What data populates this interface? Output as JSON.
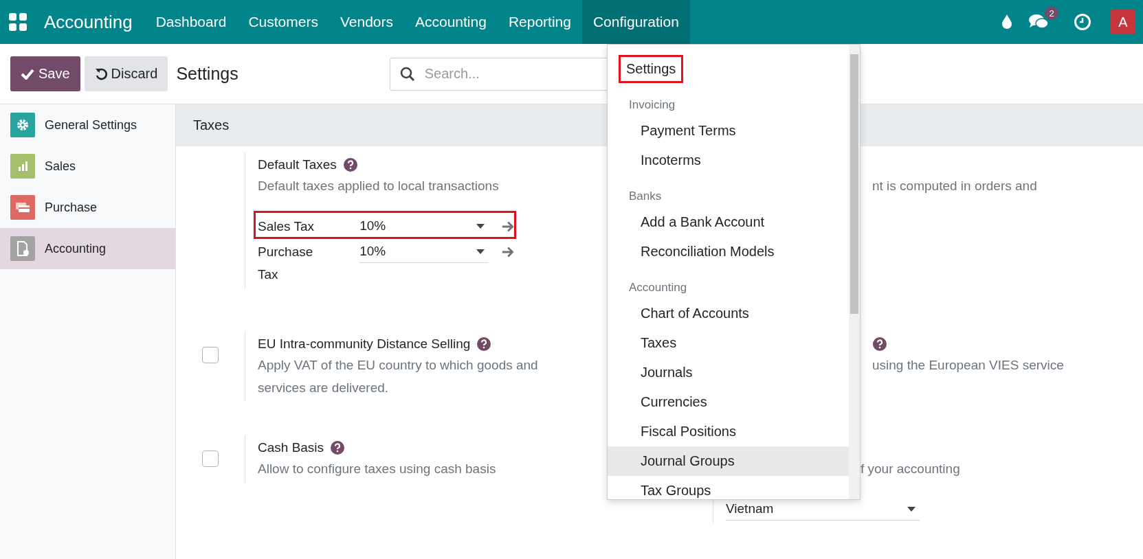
{
  "navbar": {
    "app": "Accounting",
    "menus": [
      {
        "label": "Dashboard",
        "selected": false
      },
      {
        "label": "Customers",
        "selected": false
      },
      {
        "label": "Vendors",
        "selected": false
      },
      {
        "label": "Accounting",
        "selected": false
      },
      {
        "label": "Reporting",
        "selected": false
      },
      {
        "label": "Configuration",
        "selected": true
      }
    ],
    "chat_count": "2",
    "avatar": "A"
  },
  "control_panel": {
    "buttons": [
      {
        "label": "Save",
        "kind": "primary"
      },
      {
        "label": "Discard",
        "kind": "secondary"
      }
    ],
    "title": "Settings",
    "search": {
      "placeholder": "Search..."
    }
  },
  "sidebar": {
    "items": [
      {
        "label": "General Settings",
        "color": "#27a3a0",
        "selected": false
      },
      {
        "label": "Sales",
        "color": "#a6bf6e",
        "selected": false
      },
      {
        "label": "Purchase",
        "color": "#dc6a63",
        "selected": false
      },
      {
        "label": "Accounting",
        "color": "#a3a3a3",
        "selected": true
      }
    ]
  },
  "section": {
    "title": "Taxes",
    "rows": [
      {
        "left": {
          "kind": "fields",
          "title": "Default Taxes",
          "help": true,
          "description": "Default taxes applied to local transactions",
          "fields": [
            {
              "label": "Sales Tax",
              "value": "10%",
              "highlighted": true
            },
            {
              "label": "Purchase Tax",
              "value": "10%",
              "highlighted": false
            }
          ]
        },
        "right": {
          "description": "nt is computed in orders and"
        }
      },
      {
        "left": {
          "kind": "checkbox",
          "title": "EU Intra-community Distance Selling",
          "help": true,
          "description": "Apply VAT of the EU country to which goods and services are delivered.",
          "checked": false
        },
        "right": {
          "help": true,
          "description": "using the European VIES service"
        }
      },
      {
        "left": {
          "kind": "checkbox",
          "title": "Cash Basis",
          "help": true,
          "description": "Allow to configure taxes using cash basis",
          "checked": false
        },
        "right": {
          "description": "f your accounting",
          "select": "Vietnam"
        }
      }
    ]
  },
  "dropdown": {
    "items": [
      {
        "kind": "item",
        "label": "Settings",
        "highlighted": true,
        "active": false
      },
      {
        "kind": "header",
        "label": "Invoicing"
      },
      {
        "kind": "item",
        "label": "Payment Terms",
        "highlighted": false,
        "active": false
      },
      {
        "kind": "item",
        "label": "Incoterms",
        "highlighted": false,
        "active": false
      },
      {
        "kind": "header",
        "label": "Banks"
      },
      {
        "kind": "item",
        "label": "Add a Bank Account",
        "highlighted": false,
        "active": false
      },
      {
        "kind": "item",
        "label": "Reconciliation Models",
        "highlighted": false,
        "active": false
      },
      {
        "kind": "header",
        "label": "Accounting"
      },
      {
        "kind": "item",
        "label": "Chart of Accounts",
        "highlighted": false,
        "active": false
      },
      {
        "kind": "item",
        "label": "Taxes",
        "highlighted": false,
        "active": false
      },
      {
        "kind": "item",
        "label": "Journals",
        "highlighted": false,
        "active": false
      },
      {
        "kind": "item",
        "label": "Currencies",
        "highlighted": false,
        "active": false
      },
      {
        "kind": "item",
        "label": "Fiscal Positions",
        "highlighted": false,
        "active": false
      },
      {
        "kind": "item",
        "label": "Journal Groups",
        "highlighted": false,
        "active": true
      },
      {
        "kind": "item",
        "label": "Tax Groups",
        "highlighted": false,
        "active": false
      }
    ]
  }
}
